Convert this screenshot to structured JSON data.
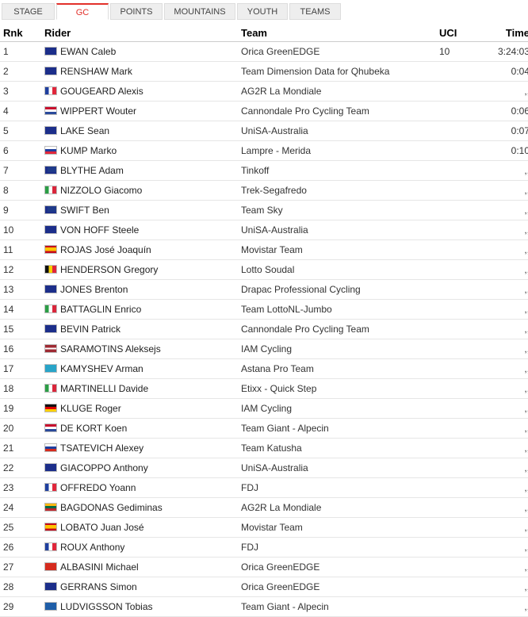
{
  "tabs": [
    "STAGE",
    "GC",
    "POINTS",
    "MOUNTAINS",
    "YOUTH",
    "TEAMS"
  ],
  "active_tab": "GC",
  "headers": {
    "rnk": "Rnk",
    "rider": "Rider",
    "team": "Team",
    "uci": "UCI",
    "time": "Time"
  },
  "rows": [
    {
      "rnk": "1",
      "flag": "au",
      "rider": "EWAN Caleb",
      "team": "Orica GreenEDGE",
      "uci": "10",
      "time": "3:24:03"
    },
    {
      "rnk": "2",
      "flag": "au",
      "rider": "RENSHAW Mark",
      "team": "Team Dimension Data for Qhubeka",
      "uci": "",
      "time": "0:04"
    },
    {
      "rnk": "3",
      "flag": "fr",
      "rider": "GOUGEARD Alexis",
      "team": "AG2R La Mondiale",
      "uci": "",
      "time": ",,"
    },
    {
      "rnk": "4",
      "flag": "nl",
      "rider": "WIPPERT Wouter",
      "team": "Cannondale Pro Cycling Team",
      "uci": "",
      "time": "0:06"
    },
    {
      "rnk": "5",
      "flag": "au",
      "rider": "LAKE Sean",
      "team": "UniSA-Australia",
      "uci": "",
      "time": "0:07"
    },
    {
      "rnk": "6",
      "flag": "si",
      "rider": "KUMP Marko",
      "team": "Lampre - Merida",
      "uci": "",
      "time": "0:10"
    },
    {
      "rnk": "7",
      "flag": "gb",
      "rider": "BLYTHE Adam",
      "team": "Tinkoff",
      "uci": "",
      "time": ",,"
    },
    {
      "rnk": "8",
      "flag": "it",
      "rider": "NIZZOLO Giacomo",
      "team": "Trek-Segafredo",
      "uci": "",
      "time": ",,"
    },
    {
      "rnk": "9",
      "flag": "gb",
      "rider": "SWIFT Ben",
      "team": "Team Sky",
      "uci": "",
      "time": ",,"
    },
    {
      "rnk": "10",
      "flag": "au",
      "rider": "VON HOFF Steele",
      "team": "UniSA-Australia",
      "uci": "",
      "time": ",,"
    },
    {
      "rnk": "11",
      "flag": "es",
      "rider": "ROJAS José Joaquín",
      "team": "Movistar Team",
      "uci": "",
      "time": ",,"
    },
    {
      "rnk": "12",
      "flag": "be",
      "rider": "HENDERSON Gregory",
      "team": "Lotto Soudal",
      "uci": "",
      "time": ",,"
    },
    {
      "rnk": "13",
      "flag": "au",
      "rider": "JONES Brenton",
      "team": "Drapac Professional Cycling",
      "uci": "",
      "time": ",,"
    },
    {
      "rnk": "14",
      "flag": "it",
      "rider": "BATTAGLIN Enrico",
      "team": "Team LottoNL-Jumbo",
      "uci": "",
      "time": ",,"
    },
    {
      "rnk": "15",
      "flag": "au",
      "rider": "BEVIN Patrick",
      "team": "Cannondale Pro Cycling Team",
      "uci": "",
      "time": ",,"
    },
    {
      "rnk": "16",
      "flag": "lv",
      "rider": "SARAMOTINS Aleksejs",
      "team": "IAM Cycling",
      "uci": "",
      "time": ",,"
    },
    {
      "rnk": "17",
      "flag": "kz",
      "rider": "KAMYSHEV Arman",
      "team": "Astana Pro Team",
      "uci": "",
      "time": ",,"
    },
    {
      "rnk": "18",
      "flag": "it",
      "rider": "MARTINELLI Davide",
      "team": "Etixx - Quick Step",
      "uci": "",
      "time": ",,"
    },
    {
      "rnk": "19",
      "flag": "de",
      "rider": "KLUGE Roger",
      "team": "IAM Cycling",
      "uci": "",
      "time": ",,"
    },
    {
      "rnk": "20",
      "flag": "nl",
      "rider": "DE KORT Koen",
      "team": "Team Giant - Alpecin",
      "uci": "",
      "time": ",,"
    },
    {
      "rnk": "21",
      "flag": "ru",
      "rider": "TSATEVICH Alexey",
      "team": "Team Katusha",
      "uci": "",
      "time": ",,"
    },
    {
      "rnk": "22",
      "flag": "au",
      "rider": "GIACOPPO Anthony",
      "team": "UniSA-Australia",
      "uci": "",
      "time": ",,"
    },
    {
      "rnk": "23",
      "flag": "fr",
      "rider": "OFFREDO Yoann",
      "team": "FDJ",
      "uci": "",
      "time": ",,"
    },
    {
      "rnk": "24",
      "flag": "lt",
      "rider": "BAGDONAS Gediminas",
      "team": "AG2R La Mondiale",
      "uci": "",
      "time": ",,"
    },
    {
      "rnk": "25",
      "flag": "es",
      "rider": "LOBATO Juan José",
      "team": "Movistar Team",
      "uci": "",
      "time": ",,"
    },
    {
      "rnk": "26",
      "flag": "fr",
      "rider": "ROUX Anthony",
      "team": "FDJ",
      "uci": "",
      "time": ",,"
    },
    {
      "rnk": "27",
      "flag": "ch",
      "rider": "ALBASINI Michael",
      "team": "Orica GreenEDGE",
      "uci": "",
      "time": ",,"
    },
    {
      "rnk": "28",
      "flag": "au",
      "rider": "GERRANS Simon",
      "team": "Orica GreenEDGE",
      "uci": "",
      "time": ",,"
    },
    {
      "rnk": "29",
      "flag": "se",
      "rider": "LUDVIGSSON Tobias",
      "team": "Team Giant - Alpecin",
      "uci": "",
      "time": ",,"
    }
  ]
}
